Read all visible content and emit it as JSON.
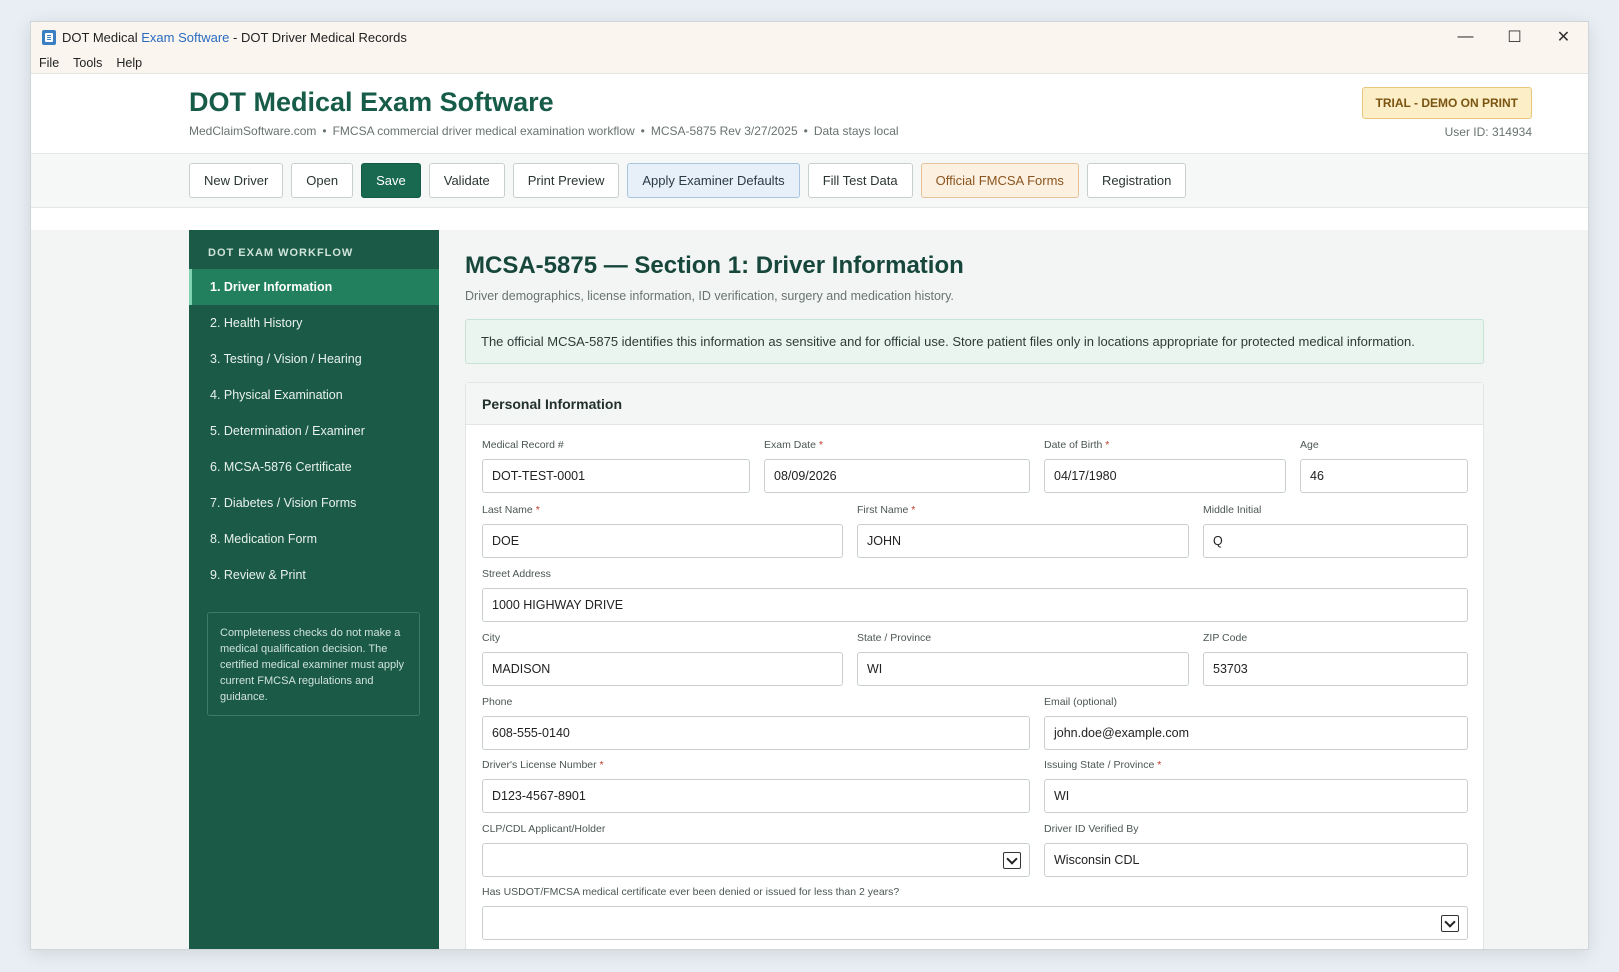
{
  "window": {
    "title_prefix": "DOT Medical",
    "title_highlight": "Exam Software",
    "title_suffix": " - DOT Driver Medical Records",
    "minimize_glyph": "—",
    "maximize_glyph": "☐",
    "close_glyph": "✕"
  },
  "menu": {
    "file": "File",
    "tools": "Tools",
    "help": "Help"
  },
  "header": {
    "brand": "DOT Medical Exam Software",
    "site": "MedClaimSoftware.com",
    "workflow": "FMCSA commercial driver medical examination workflow",
    "revision": "MCSA-5875 Rev 3/27/2025",
    "local": "Data stays local",
    "separator": "•",
    "trial_badge": "TRIAL - DEMO ON PRINT",
    "user_id": "User ID: 314934"
  },
  "toolbar": {
    "new_driver": "New Driver",
    "open": "Open",
    "save": "Save",
    "validate": "Validate",
    "print_preview": "Print Preview",
    "apply_defaults": "Apply Examiner Defaults",
    "fill_test": "Fill Test Data",
    "official_forms": "Official FMCSA Forms",
    "registration": "Registration"
  },
  "sidebar": {
    "title": "DOT EXAM WORKFLOW",
    "items": [
      "1. Driver Information",
      "2. Health History",
      "3. Testing / Vision / Hearing",
      "4. Physical Examination",
      "5. Determination / Examiner",
      "6. MCSA-5876 Certificate",
      "7. Diabetes / Vision Forms",
      "8. Medication Form",
      "9. Review & Print"
    ],
    "note": "Completeness checks do not make a medical qualification decision. The certified medical examiner must apply current FMCSA regulations and guidance."
  },
  "main": {
    "title": "MCSA-5875 — Section 1: Driver Information",
    "description": "Driver demographics, license information, ID verification, surgery and medication history.",
    "notice": "The official MCSA-5875 identifies this information as sensitive and for official use. Store patient files only in locations appropriate for protected medical information.",
    "card_title": "Personal Information",
    "required_mark": "*"
  },
  "fields": {
    "medical_record": {
      "label": "Medical Record #",
      "value": "DOT-TEST-0001"
    },
    "exam_date": {
      "label": "Exam Date",
      "value": "08/09/2026"
    },
    "dob": {
      "label": "Date of Birth",
      "value": "04/17/1980"
    },
    "age": {
      "label": "Age",
      "value": "46"
    },
    "last_name": {
      "label": "Last Name",
      "value": "DOE"
    },
    "first_name": {
      "label": "First Name",
      "value": "JOHN"
    },
    "middle_initial": {
      "label": "Middle Initial",
      "value": "Q"
    },
    "street": {
      "label": "Street Address",
      "value": "1000 HIGHWAY DRIVE"
    },
    "city": {
      "label": "City",
      "value": "MADISON"
    },
    "state": {
      "label": "State / Province",
      "value": "WI"
    },
    "zip": {
      "label": "ZIP Code",
      "value": "53703"
    },
    "phone": {
      "label": "Phone",
      "value": "608-555-0140"
    },
    "email": {
      "label": "Email (optional)",
      "value": "john.doe@example.com"
    },
    "license_number": {
      "label": "Driver's License Number",
      "value": "D123-4567-8901"
    },
    "issuing_state": {
      "label": "Issuing State / Province",
      "value": "WI"
    },
    "clp_cdl": {
      "label": "CLP/CDL Applicant/Holder",
      "value": ""
    },
    "id_verified": {
      "label": "Driver ID Verified By",
      "value": "Wisconsin CDL"
    },
    "cert_denied": {
      "label": "Has USDOT/FMCSA medical certificate ever been denied or issued for less than 2 years?",
      "value": ""
    }
  },
  "colors": {
    "brand_green": "#175c48",
    "sidebar_bg": "#1b5a46",
    "active_nav": "#22805f",
    "save_button": "#186950",
    "required": "#c0392b"
  }
}
